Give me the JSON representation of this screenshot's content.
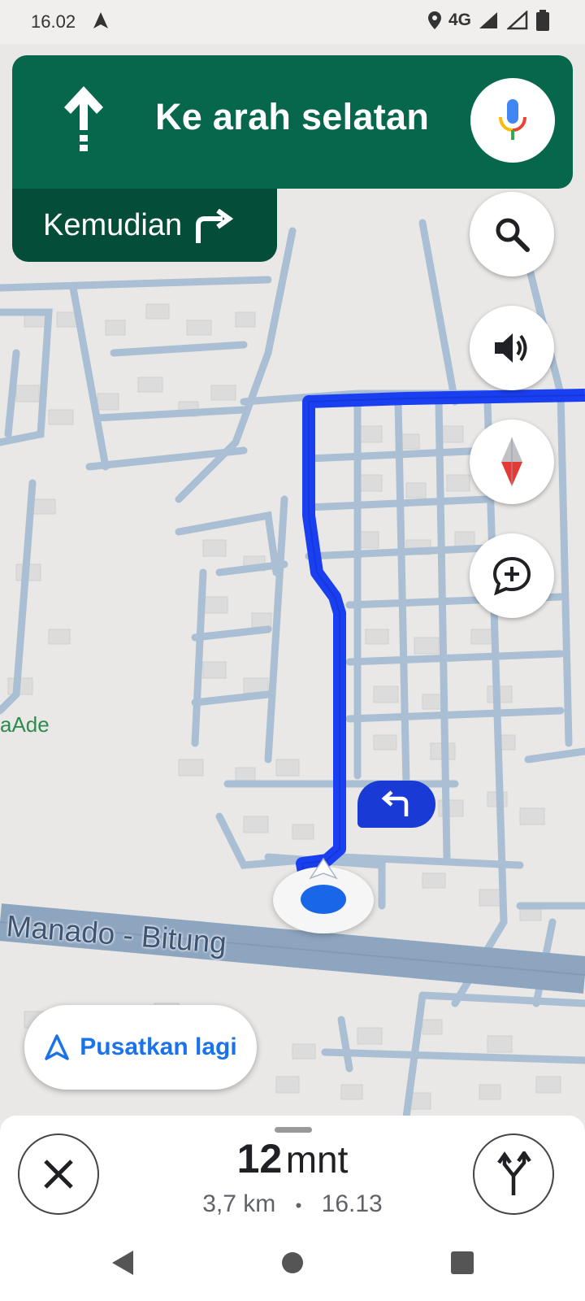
{
  "status_bar": {
    "time": "16.02",
    "network": "4G"
  },
  "navigation": {
    "instruction": "Ke arah selatan",
    "then_label": "Kemudian",
    "banner_color": "#07674c",
    "then_color": "#044e39",
    "route_color": "#1a3ff0"
  },
  "map": {
    "road_label": "Manado - Bitung",
    "poi_label": "aAde"
  },
  "buttons": {
    "recenter_label": "Pusatkan lagi"
  },
  "trip": {
    "duration_value": "12",
    "duration_unit": "mnt",
    "distance": "3,7 km",
    "separator": "•",
    "arrival_time": "16.13"
  },
  "icons": {
    "mic": "mic-icon",
    "search": "search-icon",
    "volume": "volume-icon",
    "compass": "compass-icon",
    "add_report": "add-report-icon",
    "close": "close-icon",
    "alternate_routes": "alternate-routes-icon"
  }
}
